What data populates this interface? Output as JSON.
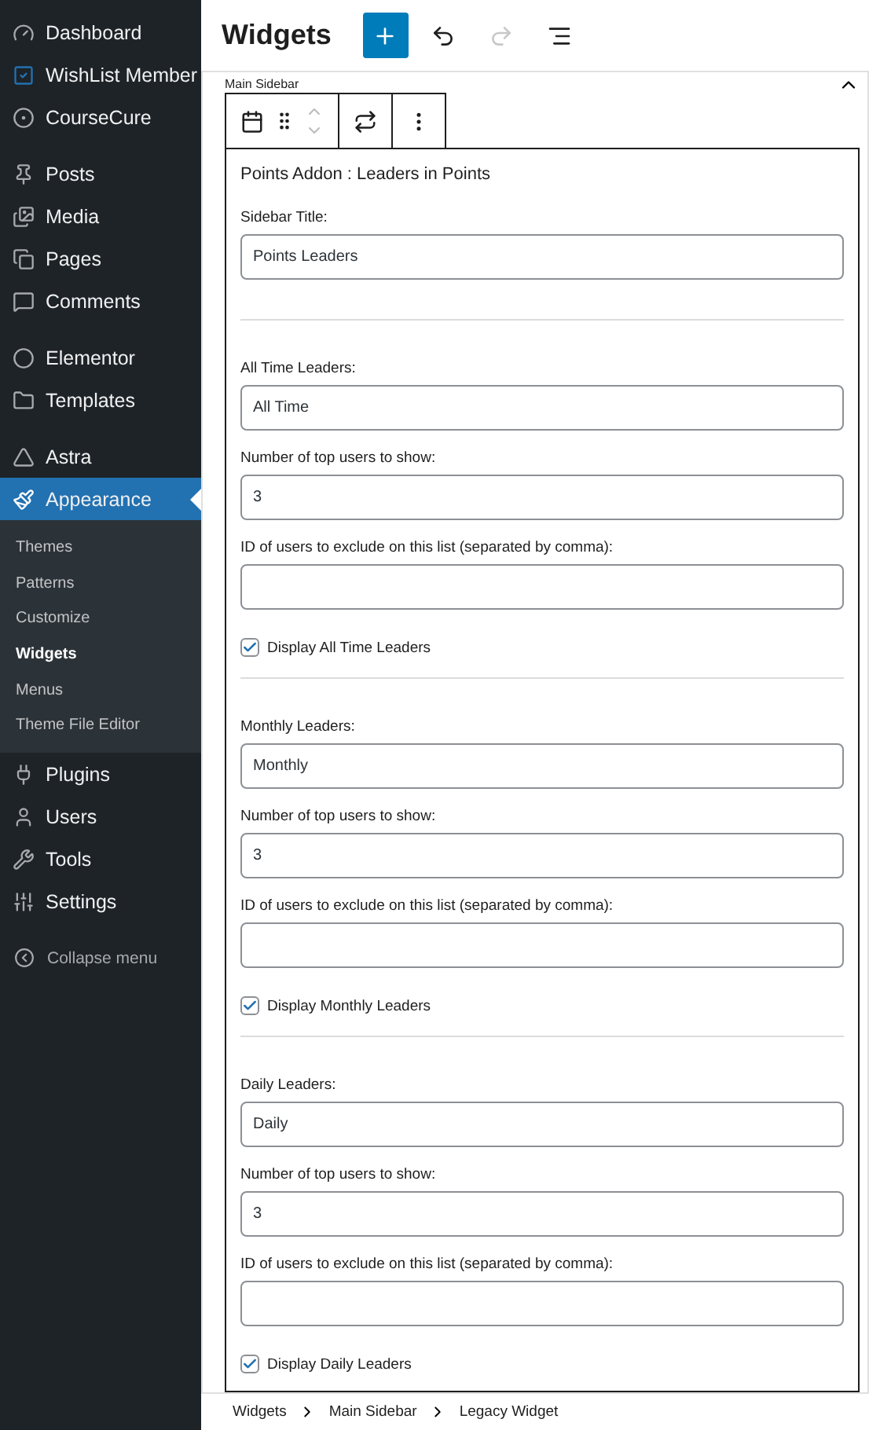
{
  "sidebar": {
    "groups": [
      [
        {
          "label": "Dashboard",
          "selected": false
        },
        {
          "label": "WishList Member",
          "selected": false
        },
        {
          "label": "CourseCure",
          "selected": false
        }
      ],
      [
        {
          "label": "Posts",
          "selected": false
        },
        {
          "label": "Media",
          "selected": false
        },
        {
          "label": "Pages",
          "selected": false
        },
        {
          "label": "Comments",
          "selected": false
        }
      ],
      [
        {
          "label": "Elementor",
          "selected": false
        },
        {
          "label": "Templates",
          "selected": false
        }
      ],
      [
        {
          "label": "Astra",
          "selected": false
        },
        {
          "label": "Appearance",
          "selected": true,
          "children": [
            {
              "label": "Themes",
              "selected": false
            },
            {
              "label": "Patterns",
              "selected": false
            },
            {
              "label": "Customize",
              "selected": false
            },
            {
              "label": "Widgets",
              "selected": true
            },
            {
              "label": "Menus",
              "selected": false
            },
            {
              "label": "Theme File Editor",
              "selected": false
            }
          ]
        },
        {
          "label": "Plugins",
          "selected": false
        },
        {
          "label": "Users",
          "selected": false
        },
        {
          "label": "Tools",
          "selected": false
        },
        {
          "label": "Settings",
          "selected": false
        }
      ]
    ],
    "collapse": "Collapse menu"
  },
  "header": {
    "title": "Widgets",
    "buttons": [
      {
        "kind": "add",
        "disabled": false
      },
      {
        "kind": "undo",
        "disabled": false
      },
      {
        "kind": "redo",
        "disabled": true
      },
      {
        "kind": "list",
        "disabled": false
      }
    ]
  },
  "area": {
    "title": "Main Sidebar",
    "expanded": true
  },
  "widget": {
    "title": "Points Addon : Leaders in Points",
    "groups": [
      [
        {
          "kind": "field",
          "label": "Sidebar Title:",
          "value": "Points Leaders"
        }
      ],
      [
        {
          "kind": "field",
          "label": "All Time Leaders:",
          "value": "All Time"
        },
        {
          "kind": "field",
          "label": "Number of top users to show:",
          "value": "3"
        },
        {
          "kind": "field",
          "label": "ID of users to exclude on this list (separated by comma):"
        },
        {
          "kind": "checkbox",
          "label": "Display All Time Leaders",
          "checked": true
        }
      ],
      [
        {
          "kind": "field",
          "label": "Monthly Leaders:",
          "value": "Monthly"
        },
        {
          "kind": "field",
          "label": "Number of top users to show:",
          "value": "3"
        },
        {
          "kind": "field",
          "label": "ID of users to exclude on this list (separated by comma):"
        },
        {
          "kind": "checkbox",
          "label": "Display Monthly Leaders",
          "checked": true
        }
      ],
      [
        {
          "kind": "field",
          "label": "Daily Leaders:",
          "value": "Daily"
        },
        {
          "kind": "field",
          "label": "Number of top users to show:",
          "value": "3"
        },
        {
          "kind": "field",
          "label": "ID of users to exclude on this list (separated by comma):"
        },
        {
          "kind": "checkbox",
          "label": "Display Daily Leaders",
          "checked": true
        }
      ]
    ]
  },
  "breadcrumbs": [
    "Widgets",
    "Main Sidebar",
    "Legacy Widget"
  ]
}
